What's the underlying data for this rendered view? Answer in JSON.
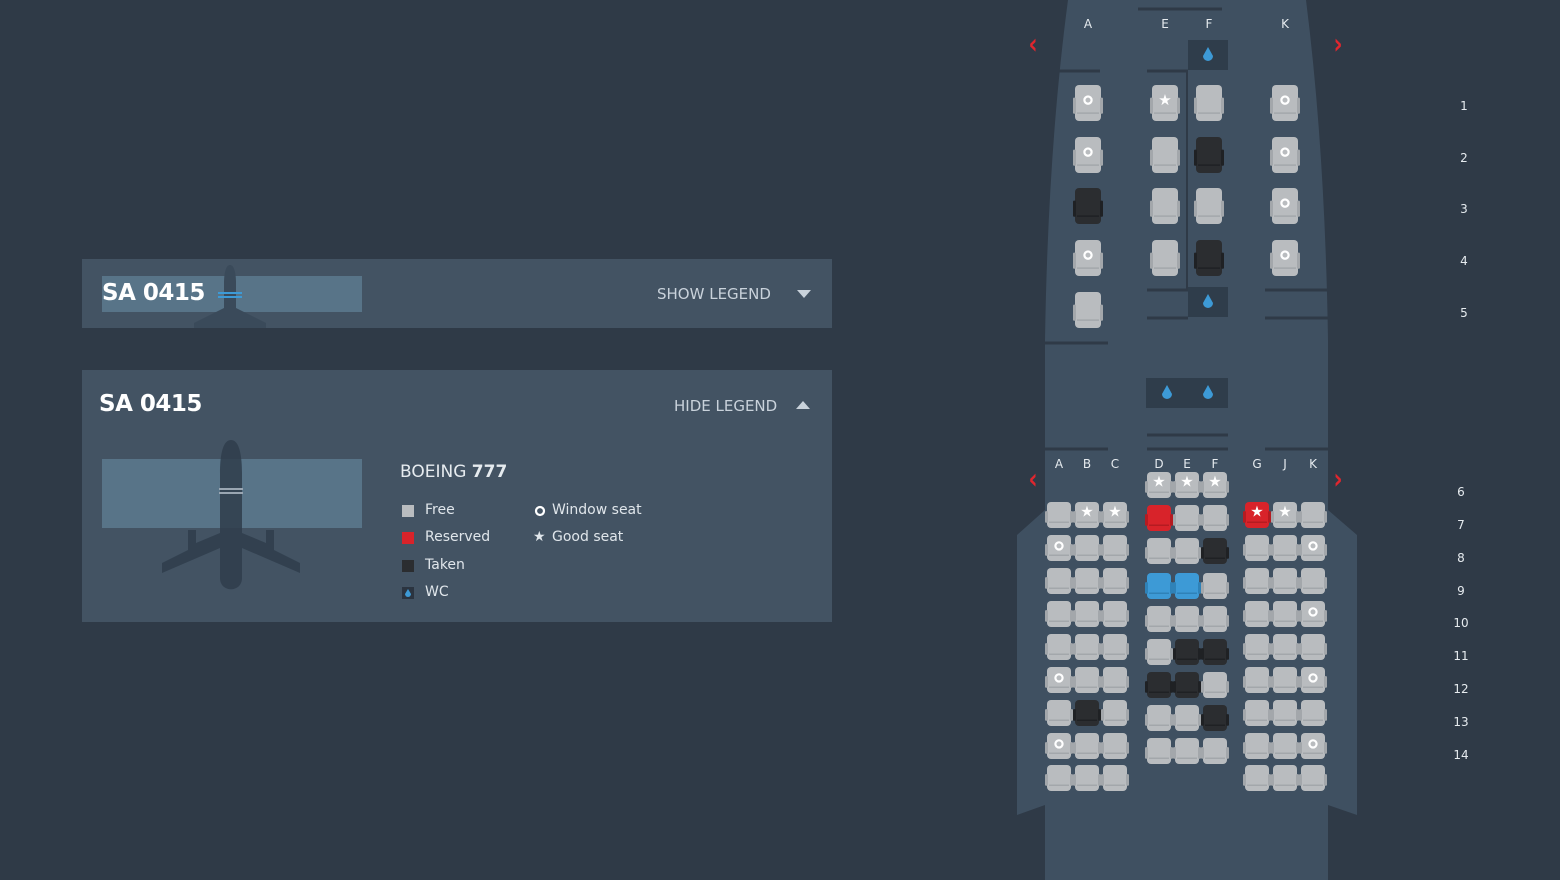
{
  "colors": {
    "background": "#2f3a47",
    "panel": "#435363",
    "fuselage": "#3f5061",
    "free": "#b9bcbf",
    "reserved": "#d8232a",
    "taken": "#2b2d30",
    "selected": "#3d9ad6",
    "wc": "#3d9ad6",
    "arrow": "#e0262e"
  },
  "collapsed_panel": {
    "flight": "SA 0415",
    "toggle": "SHOW LEGEND",
    "toggle_icon": "triangle-down-icon"
  },
  "expanded_panel": {
    "flight": "SA 0415",
    "toggle": "HIDE LEGEND",
    "toggle_icon": "triangle-up-icon",
    "model_prefix": "BOEING",
    "model_number": "777",
    "legend": [
      {
        "label": "Free",
        "icon": "free-square"
      },
      {
        "label": "Reserved",
        "icon": "reserved-square"
      },
      {
        "label": "Taken",
        "icon": "taken-square"
      },
      {
        "label": "WC",
        "icon": "wc-drop-icon"
      },
      {
        "label": "Window seat",
        "icon": "ring-icon"
      },
      {
        "label": "Good seat",
        "icon": "star-icon"
      }
    ]
  },
  "seatmap": {
    "upper": {
      "columns": [
        "A",
        "E",
        "F",
        "K"
      ],
      "rows": [
        "1",
        "2",
        "3",
        "4",
        "5"
      ],
      "seats": [
        [
          "w",
          "g",
          "f",
          "w"
        ],
        [
          "w",
          "f",
          "t",
          "w"
        ],
        [
          "t",
          "f",
          "f",
          "w"
        ],
        [
          "w",
          "f",
          "t",
          "w"
        ],
        [
          "f",
          "",
          "",
          ""
        ]
      ]
    },
    "lower": {
      "columns": [
        "A",
        "B",
        "C",
        "D",
        "E",
        "F",
        "G",
        "J",
        "K"
      ],
      "rows": [
        "6",
        "7",
        "8",
        "9",
        "10",
        "11",
        "12",
        "13",
        "14"
      ],
      "left": [
        [
          "f",
          "g",
          "g"
        ],
        [
          "w",
          "f",
          "f"
        ],
        [
          "f",
          "f",
          "f"
        ],
        [
          "f",
          "f",
          "f"
        ],
        [
          "f",
          "f",
          "f"
        ],
        [
          "w",
          "f",
          "f"
        ],
        [
          "f",
          "t",
          "f"
        ],
        [
          "w",
          "f",
          "f"
        ],
        [
          "f",
          "f",
          "f"
        ]
      ],
      "middle": [
        [
          "g",
          "g",
          "g"
        ],
        [
          "r",
          "f",
          "f"
        ],
        [
          "f",
          "f",
          "t"
        ],
        [
          "s",
          "s",
          "f"
        ],
        [
          "f",
          "f",
          "f"
        ],
        [
          "f",
          "t",
          "t"
        ],
        [
          "t",
          "t",
          "f"
        ],
        [
          "f",
          "f",
          "t"
        ],
        [
          "f",
          "f",
          "f"
        ]
      ],
      "right": [
        [
          "rg",
          "g",
          "f"
        ],
        [
          "f",
          "f",
          "w"
        ],
        [
          "f",
          "f",
          "f"
        ],
        [
          "f",
          "f",
          "w"
        ],
        [
          "f",
          "f",
          "f"
        ],
        [
          "f",
          "f",
          "w"
        ],
        [
          "f",
          "f",
          "f"
        ],
        [
          "f",
          "f",
          "w"
        ],
        [
          "f",
          "f",
          "f"
        ]
      ]
    },
    "nav": {
      "prev_icon": "chevron-left-icon",
      "next_icon": "chevron-right-icon"
    }
  }
}
